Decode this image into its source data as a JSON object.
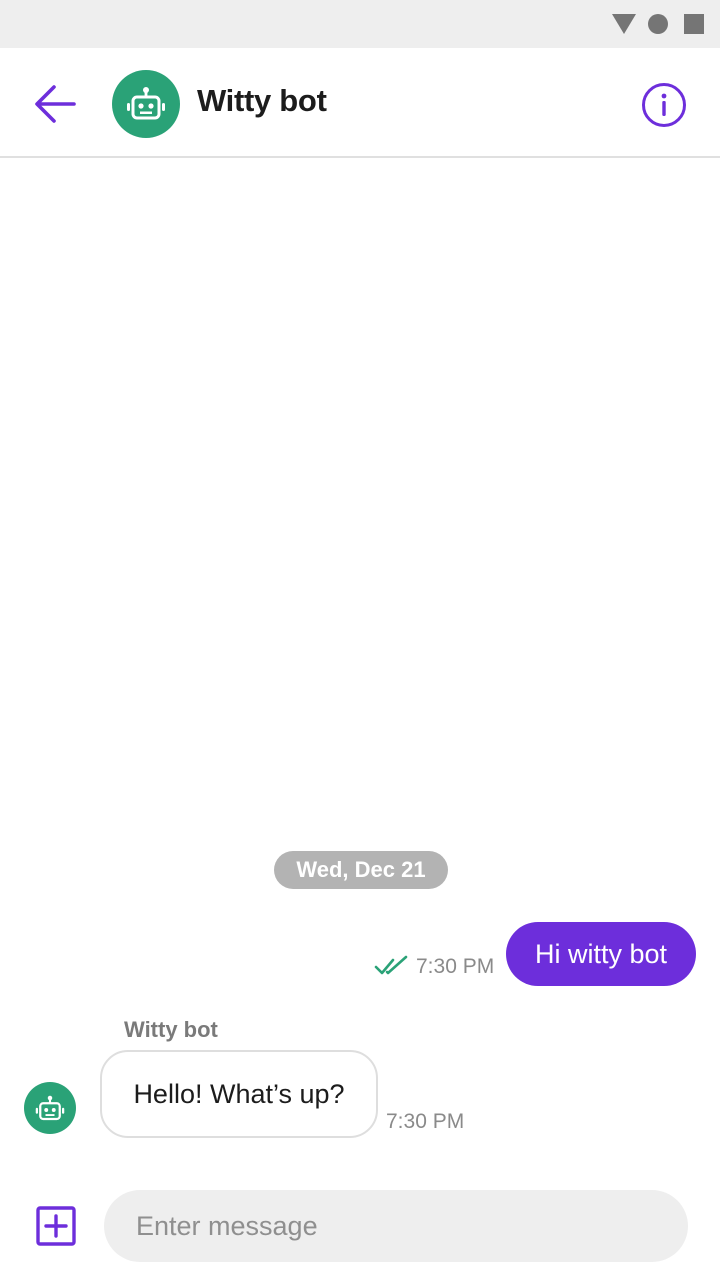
{
  "app_bar": {
    "title": "Witty bot",
    "back_icon": "arrow-back-icon",
    "avatar_icon": "robot-icon",
    "info_icon": "info-icon"
  },
  "conversation": {
    "date_chip": "Wed, Dec 21",
    "messages": [
      {
        "direction": "outgoing",
        "text": "Hi witty bot",
        "time": "7:30 PM",
        "status_icon": "double-check-icon"
      },
      {
        "direction": "incoming",
        "sender": "Witty bot",
        "text": "Hello! What’s up?",
        "time": "7:30 PM",
        "avatar_icon": "robot-icon"
      }
    ]
  },
  "composer": {
    "placeholder": "Enter message",
    "value": "",
    "add_icon": "add-square-icon"
  },
  "colors": {
    "accent": "#6d2edb",
    "bot_avatar": "#2aa277",
    "status_bar": "#eeeeee",
    "date_chip": "#b3b3b3",
    "read_ticks": "#2aa277"
  }
}
